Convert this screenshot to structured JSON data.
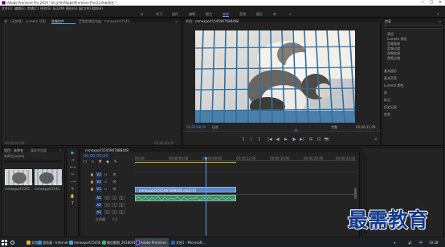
{
  "window": {
    "title": "Adobe Premiere Pro 2019 - D:\\文件\\Adobe\\Premiere Pro\\13.0\\未命名 *",
    "controls": [
      "—",
      "□",
      "✕"
    ]
  },
  "menu": [
    "文件(F)",
    "编辑(E)",
    "剪辑(C)",
    "序列(S)",
    "标记(M)",
    "图形(G)",
    "窗口(W)",
    "帮助(H)"
  ],
  "workspaces": {
    "home_icon": "home-icon",
    "items": [
      "学习",
      "组件",
      "编辑",
      "颜色",
      "效果",
      "音频",
      "图形",
      "库"
    ],
    "active_index": 4,
    "overflow": "»",
    "search_icon": "search-icon"
  },
  "source_panel": {
    "tabs": [
      "源：(无剪辑)",
      "Lumetri 范围",
      "效果控件",
      "音频剪辑混合器：mmexport1545..."
    ],
    "active_tab": 2,
    "tabs_overflow": "≡",
    "timecode_left": "00;00;00;00",
    "timecode_right": "00;00;00;00"
  },
  "program_panel": {
    "title": "节目：mmexport1545967688408",
    "menu": "≡",
    "timecode": "00;00;08;00",
    "fit": "适合",
    "quality": "完整",
    "duration": "00;00;11;09",
    "controls": [
      "{",
      "|",
      "}",
      "|◀",
      "◀|",
      "▶",
      "|▶",
      "▶|",
      "⊞",
      "⊡",
      "📷",
      "+"
    ]
  },
  "right_panel": {
    "title": "信息",
    "title_menu": "≡",
    "tree": [
      "预设",
      "Lumetri 预设",
      "音频效果",
      "音频过渡",
      "视频效果",
      "视频过渡"
    ],
    "sections": [
      "基本图形",
      "基本声音",
      "Lumetri 颜色",
      "库",
      "标记",
      "历史记录",
      "信息"
    ]
  },
  "project_panel": {
    "tabs": [
      "项目：未命名",
      "媒体浏览器"
    ],
    "more": "»",
    "file": "未命名.prproj",
    "clip_labels": [
      "mmexport1545...",
      "mmexport1545..."
    ],
    "clip_durations": [
      "11;09",
      "11;09"
    ]
  },
  "timeline": {
    "sequence": "mmexport1545967688408",
    "close": "×",
    "timecode": "00;00;08;00",
    "ruler": [
      "00;00",
      "00;00;04;00",
      "00;00;08;00",
      "00;00;12;00",
      "00;00;16;00",
      "00;00;20;00",
      "00;00;24;00"
    ],
    "tracks_video": [
      "V3",
      "V2",
      "V1"
    ],
    "tracks_audio": [
      "A1",
      "A2",
      "A3"
    ],
    "track_buttons": [
      "🔒",
      "⊟",
      "👁",
      "M",
      "S",
      "🎙"
    ],
    "master": "主声道",
    "master_value": "0.0",
    "video_clip": "mmexport1545967688408.mp4 [V]",
    "audio_clip": "",
    "tools": [
      "▶",
      "⇥",
      "⟷",
      "✂",
      "⟶",
      "✎",
      "✋",
      "T"
    ]
  },
  "watermark": "最需教育",
  "taskbar": {
    "start": "start-icon",
    "search": "search-icon",
    "apps": [
      {
        "label": "文档夹",
        "active": false
      },
      {
        "label": "游览器 - Internet ...",
        "active": false
      },
      {
        "label": "mmexport15456...",
        "active": false
      },
      {
        "label": "微信截图_2018091...",
        "active": false
      },
      {
        "label": "Adobe Premiere ...",
        "active": true
      },
      {
        "label": "文档1 - Microsoft...",
        "active": false
      }
    ],
    "tray": [
      "∧",
      "🔊",
      "中",
      "10:28"
    ]
  },
  "colors": {
    "accent": "#3b8cff",
    "video_clip": "#5b86c8",
    "audio_clip": "#3e8f6c",
    "playhead": "#4aa3ff",
    "watermark": "#143a8c"
  }
}
